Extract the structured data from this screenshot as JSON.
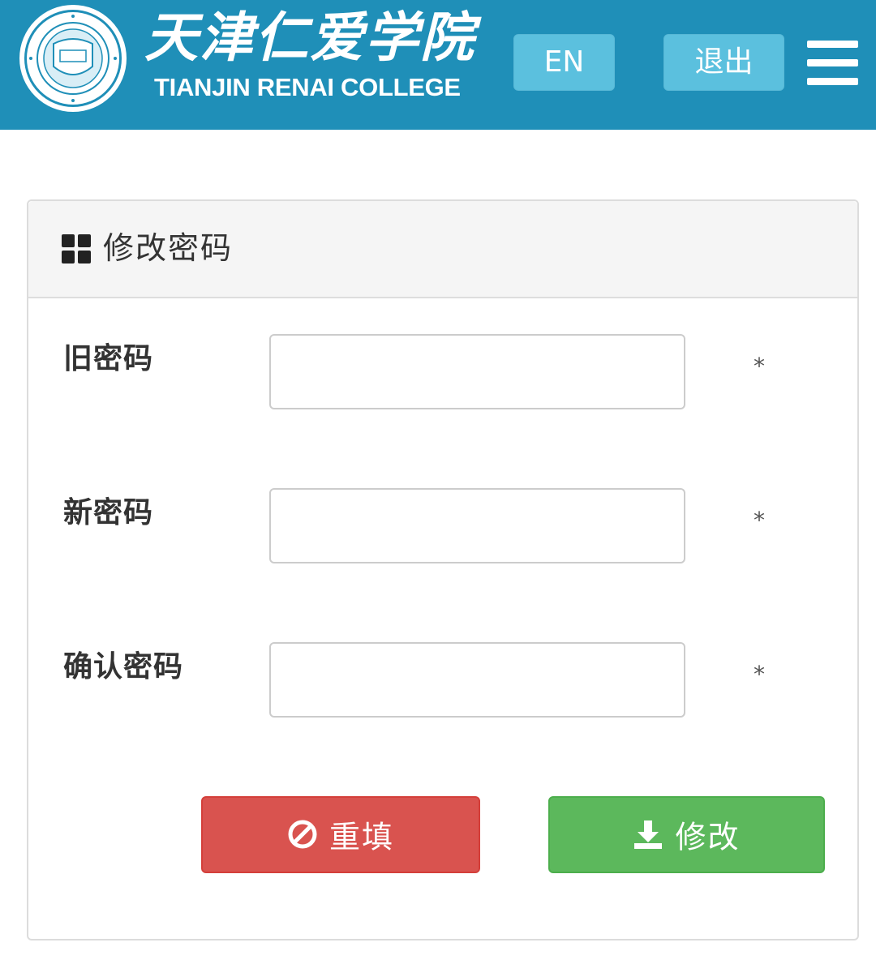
{
  "header": {
    "brand_cn": "天津仁爱学院",
    "brand_en": "TIANJIN RENAI COLLEGE",
    "lang_button": "EN",
    "exit_button": "退出",
    "accent_color": "#1f8fb8",
    "seal_icon": "college-seal-logo",
    "menu_icon": "hamburger-menu-icon"
  },
  "panel": {
    "title": "修改密码",
    "title_icon": "grid-icon"
  },
  "form": {
    "fields": [
      {
        "label": "旧密码",
        "value": "",
        "required_mark": "*"
      },
      {
        "label": "新密码",
        "value": "",
        "required_mark": "*"
      },
      {
        "label": "确认密码",
        "value": "",
        "required_mark": "*"
      }
    ],
    "reset_button": {
      "label": "重填",
      "icon": "ban-icon",
      "color": "#d9534f"
    },
    "submit_button": {
      "label": "修改",
      "icon": "download-icon",
      "color": "#5cb85c"
    }
  }
}
